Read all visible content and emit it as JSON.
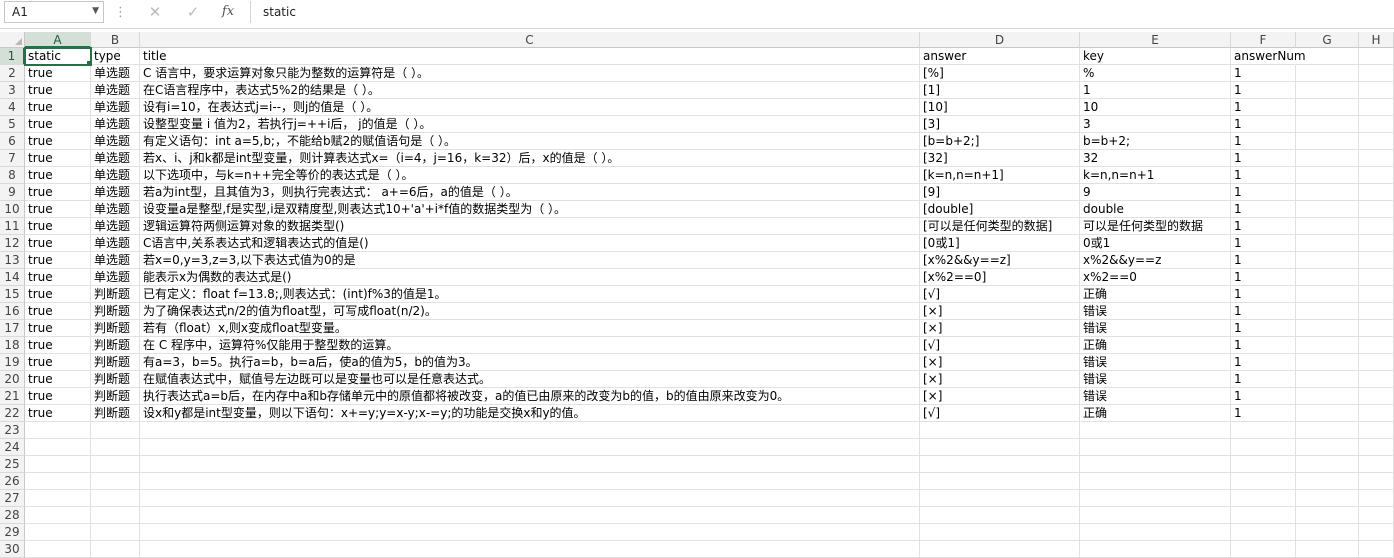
{
  "formula_bar": {
    "name_box": "A1",
    "fx_label": "fx",
    "cancel_icon": "✕",
    "enter_icon": "✓",
    "content": "static"
  },
  "columns": [
    "A",
    "B",
    "C",
    "D",
    "E",
    "F",
    "G",
    "H"
  ],
  "rows": [
    [
      "static",
      "type",
      "title",
      "answer",
      "key",
      "answerNum"
    ],
    [
      "true",
      "单选题",
      "C 语言中，要求运算对象只能为整数的运算符是（ ）。",
      "[%]",
      "%",
      "1"
    ],
    [
      "true",
      "单选题",
      "在C语言程序中，表达式5%2的结果是（ ）。",
      "[1]",
      "1",
      "1"
    ],
    [
      "true",
      "单选题",
      "设有i=10，在表达式j=i--，则j的值是（ ）。",
      "[10]",
      "10",
      "1"
    ],
    [
      "true",
      "单选题",
      "设整型变量 i 值为2，若执行j=++i后， j的值是（ ）。",
      "[3]",
      "3",
      "1"
    ],
    [
      "true",
      "单选题",
      "有定义语句：int a=5,b;，不能给b赋2的赋值语句是（ ）。",
      "[b=b+2;]",
      "b=b+2;",
      "1"
    ],
    [
      "true",
      "单选题",
      "若x、i、j和k都是int型变量，则计算表达式x=（i=4，j=16，k=32）后，x的值是（ ）。",
      "[32]",
      "32",
      "1"
    ],
    [
      "true",
      "单选题",
      "以下选项中，与k=n++完全等价的表达式是（ ）。",
      "[k=n,n=n+1]",
      "k=n,n=n+1",
      "1"
    ],
    [
      "true",
      "单选题",
      "若a为int型，且其值为3，则执行完表达式：  a+=6后，a的值是（ ）。",
      "[9]",
      "9",
      "1"
    ],
    [
      "true",
      "单选题",
      "设变量a是整型,f是实型,i是双精度型,则表达式10+'a'+i*f值的数据类型为（ ）。",
      "[double]",
      "double",
      "1"
    ],
    [
      "true",
      "单选题",
      "逻辑运算符两侧运算对象的数据类型()",
      "[可以是任何类型的数据]",
      "可以是任何类型的数据",
      "1"
    ],
    [
      "true",
      "单选题",
      "C语言中,关系表达式和逻辑表达式的值是()",
      "[0或1]",
      "0或1",
      "1"
    ],
    [
      "true",
      "单选题",
      "若x=0,y=3,z=3,以下表达式值为0的是",
      "[x%2&&y==z]",
      "x%2&&y==z",
      "1"
    ],
    [
      "true",
      "单选题",
      "能表示x为偶数的表达式是()",
      "[x%2==0]",
      "x%2==0",
      "1"
    ],
    [
      "true",
      "判断题",
      "已有定义：float f=13.8;,则表达式：(int)f%3的值是1。",
      "[√]",
      "正确",
      "1"
    ],
    [
      "true",
      "判断题",
      "为了确保表达式n/2的值为float型，可写成float(n/2)。",
      "[×]",
      "错误",
      "1"
    ],
    [
      "true",
      "判断题",
      "若有（float）x,则x变成float型变量。",
      "[×]",
      "错误",
      "1"
    ],
    [
      "true",
      "判断题",
      "在 C 程序中，运算符%仅能用于整型数的运算。",
      "[√]",
      "正确",
      "1"
    ],
    [
      "true",
      "判断题",
      "有a=3，b=5。执行a=b，b=a后，使a的值为5，b的值为3。",
      "[×]",
      "错误",
      "1"
    ],
    [
      "true",
      "判断题",
      "在赋值表达式中，赋值号左边既可以是变量也可以是任意表达式。",
      "[×]",
      "错误",
      "1"
    ],
    [
      "true",
      "判断题",
      "执行表达式a=b后，在内存中a和b存储单元中的原值都将被改变，a的值已由原来的改变为b的值，b的值由原来改变为0。",
      "[×]",
      "错误",
      "1"
    ],
    [
      "true",
      "判断题",
      "设x和y都是int型变量，则以下语句：x+=y;y=x-y;x-=y;的功能是交换x和y的值。",
      "[√]",
      "正确",
      "1"
    ],
    [
      "",
      "",
      "",
      "",
      "",
      ""
    ],
    [
      "",
      "",
      "",
      "",
      "",
      ""
    ],
    [
      "",
      "",
      "",
      "",
      "",
      ""
    ],
    [
      "",
      "",
      "",
      "",
      "",
      ""
    ],
    [
      "",
      "",
      "",
      "",
      "",
      ""
    ],
    [
      "",
      "",
      "",
      "",
      "",
      ""
    ],
    [
      "",
      "",
      "",
      "",
      "",
      ""
    ],
    [
      "",
      "",
      "",
      "",
      "",
      ""
    ]
  ]
}
